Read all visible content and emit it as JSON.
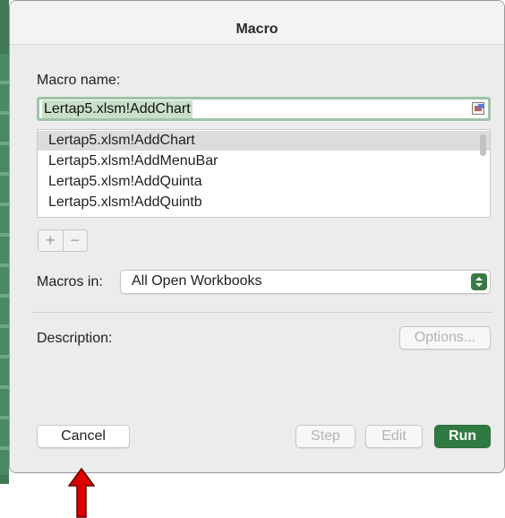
{
  "dialog": {
    "title": "Macro"
  },
  "macro_name": {
    "label": "Macro name:",
    "value": "Lertap5.xlsm!AddChart",
    "ref_button_icon": "range-select-icon"
  },
  "macro_list": {
    "items": [
      {
        "label": "Lertap5.xlsm!AddChart",
        "selected": true
      },
      {
        "label": "Lertap5.xlsm!AddMenuBar",
        "selected": false
      },
      {
        "label": "Lertap5.xlsm!AddQuinta",
        "selected": false
      },
      {
        "label": "Lertap5.xlsm!AddQuintb",
        "selected": false
      }
    ]
  },
  "list_controls": {
    "add_label": "+",
    "remove_label": "−"
  },
  "macros_in": {
    "label": "Macros in:",
    "value": "All Open Workbooks"
  },
  "description": {
    "label": "Description:"
  },
  "buttons": {
    "options": "Options...",
    "cancel": "Cancel",
    "step": "Step",
    "edit": "Edit",
    "run": "Run"
  },
  "colors": {
    "accent": "#2f7a41",
    "annotation_arrow": "#e00000"
  }
}
